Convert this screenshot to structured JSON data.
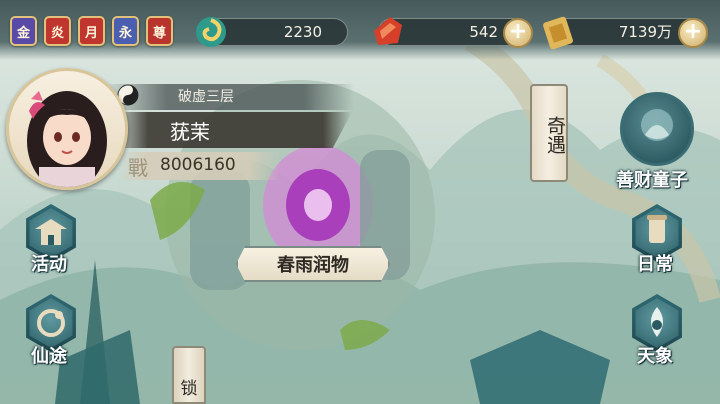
{
  "topbar": {
    "badges": [
      "金",
      "炎",
      "月",
      "永",
      "尊"
    ],
    "badge_colors": [
      "#5a4aa8",
      "#c0362e",
      "#c0362e",
      "#4b5fb0",
      "#b8342c"
    ],
    "resources": [
      {
        "icon": "jade-swirl-icon",
        "value": "2230"
      },
      {
        "icon": "red-crystal-icon",
        "value": "542"
      },
      {
        "icon": "gold-tablet-icon",
        "value": "7139万"
      }
    ]
  },
  "player": {
    "realm": "破虚三层",
    "name": "莸茉",
    "power_glyph": "戰",
    "power": "8006160"
  },
  "map": {
    "location_label": "春雨润物",
    "event_label": "奇遇"
  },
  "left_menu": {
    "activity": "活动",
    "path": "仙途",
    "locked": "锁"
  },
  "right_menu": {
    "god_of_wealth": "善财童子",
    "daily": "日常",
    "celestial": "天象"
  }
}
